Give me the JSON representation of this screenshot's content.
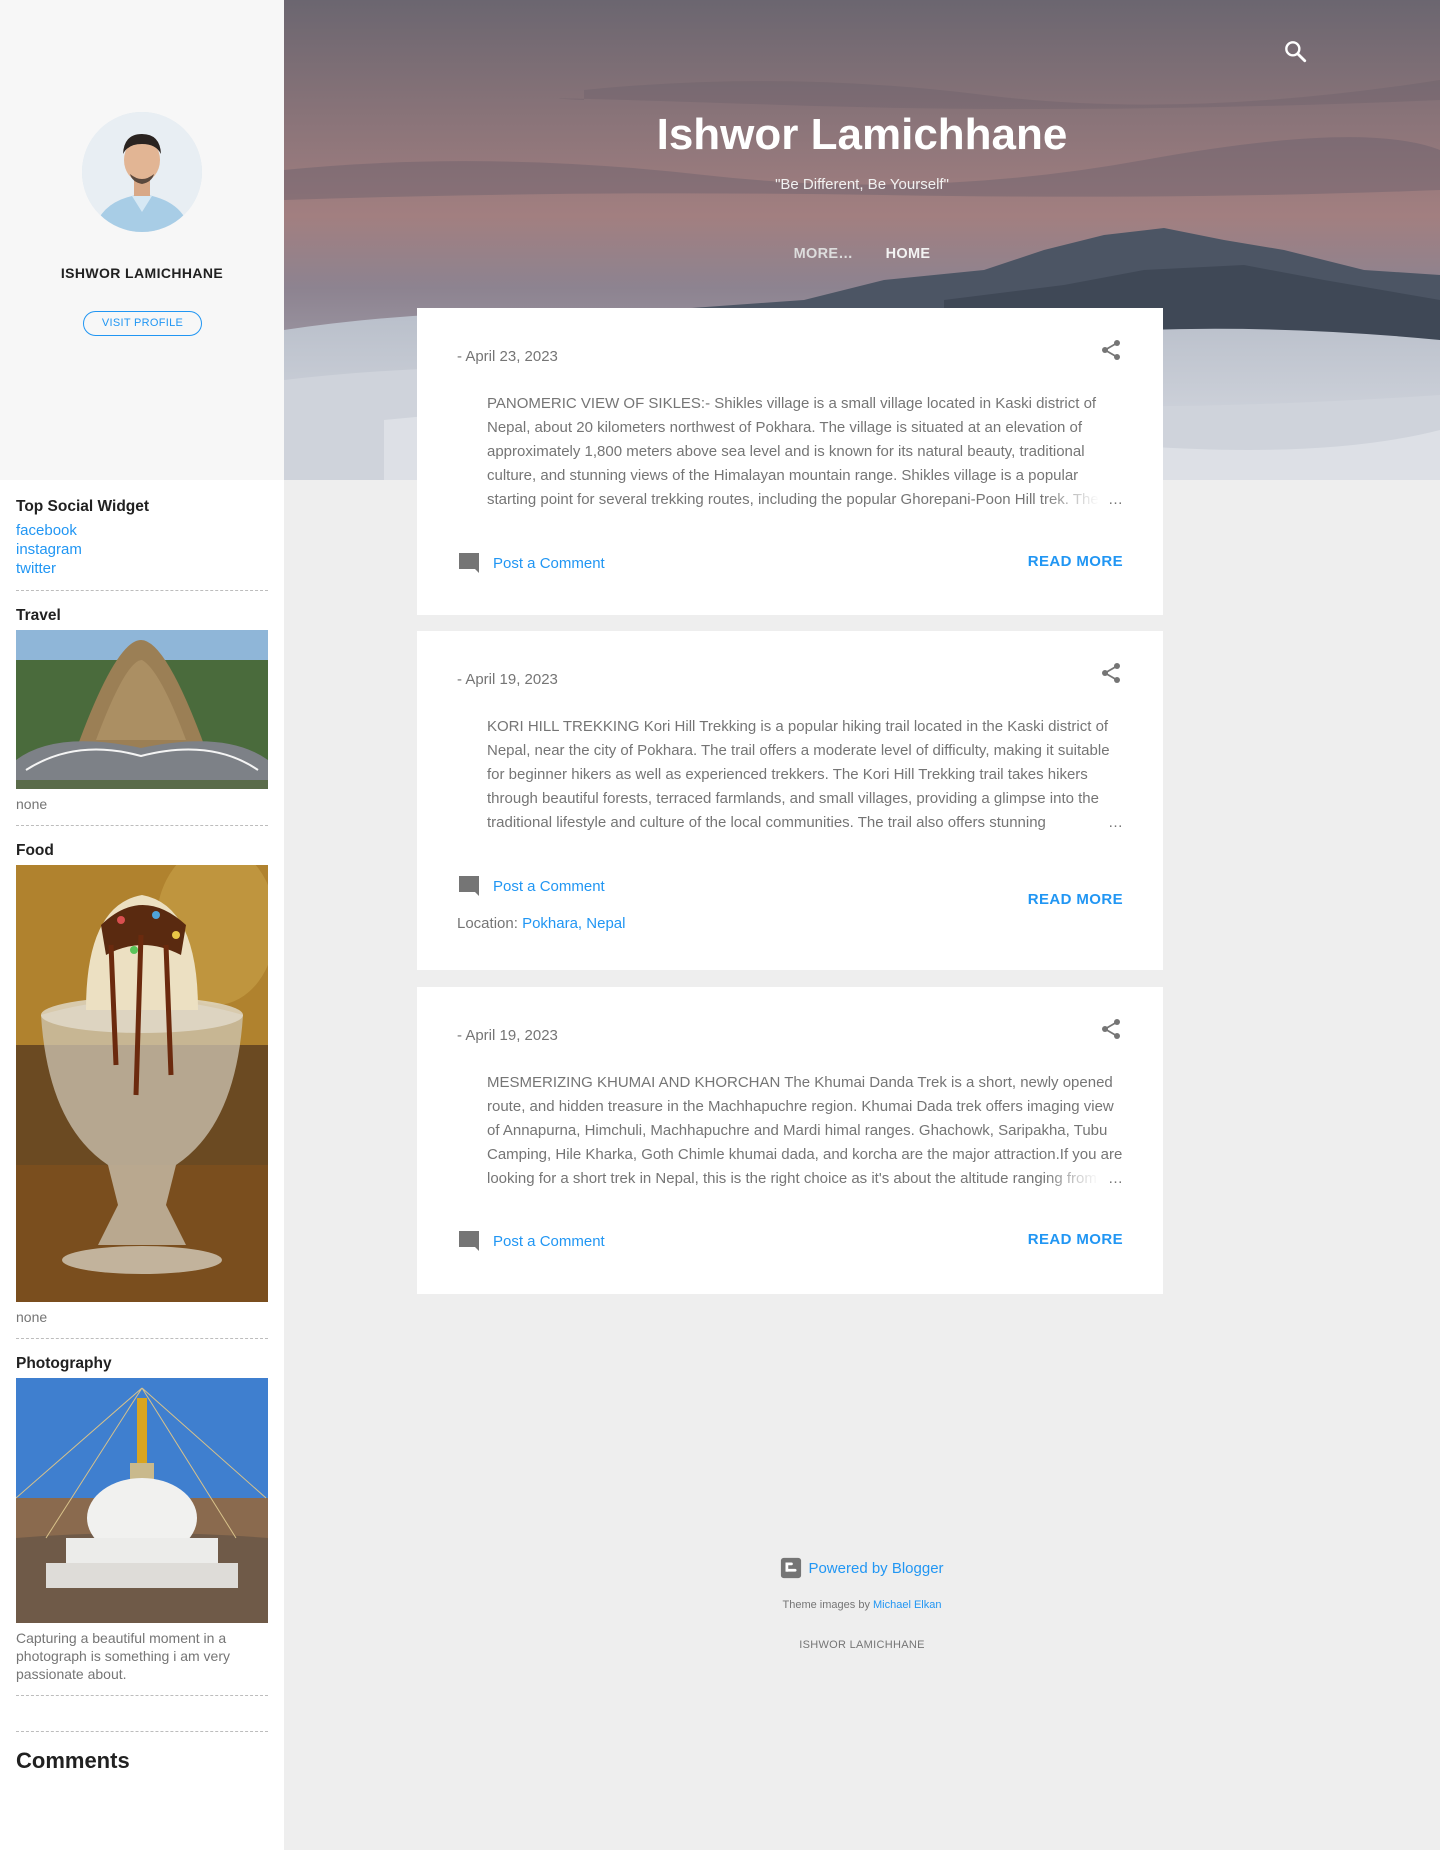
{
  "profile": {
    "name": "ISHWOR LAMICHHANE",
    "visit_label": "VISIT PROFILE"
  },
  "header": {
    "title": "Ishwor Lamichhane",
    "description": "\"Be Different, Be Yourself\"",
    "nav": [
      "MORE…",
      "HOME"
    ]
  },
  "sidebar": {
    "social": {
      "title": "Top Social Widget",
      "links": [
        "facebook",
        "instagram",
        "twitter"
      ]
    },
    "travel": {
      "title": "Travel",
      "caption": "none"
    },
    "food": {
      "title": "Food",
      "caption": "none"
    },
    "photography": {
      "title": "Photography",
      "caption": "Capturing a beautiful moment in a photograph is something i am very passionate about."
    },
    "comments_title": "Comments"
  },
  "posts": [
    {
      "date": "- April 23, 2023",
      "snippet": "PANOMERIC VIEW OF SIKLES:-  Shikles village is a small village located in Kaski district of Nepal, about 20 kilometers northwest of Pokhara. The village is situated at an elevation of approximately 1,800 meters above sea level and is known for its natural beauty, traditional culture, and stunning views of the Himalayan mountain range. Shikles village is a popular starting point for several trekking routes, including the popular Ghorepani-Poon Hill trek. The",
      "ellipsis": "…",
      "comment_label": "Post a Comment",
      "read_more": "READ MORE"
    },
    {
      "date": "- April 19, 2023",
      "snippet": " KORI HILL TREKKING Kori Hill Trekking is a popular hiking trail located in the Kaski district of Nepal, near the city of Pokhara. The trail offers a moderate level of difficulty, making it suitable for beginner hikers as well as experienced trekkers. The Kori Hill Trekking trail takes hikers through beautiful forests, terraced farmlands, and small villages, providing a glimpse into the traditional lifestyle and culture of the local communities. The trail also offers stunning",
      "ellipsis": "…",
      "comment_label": "Post a Comment",
      "read_more": "READ MORE",
      "location_label": "Location:",
      "location": "Pokhara, Nepal"
    },
    {
      "date": "- April 19, 2023",
      "snippet": "  MESMERIZING KHUMAI AND KHORCHAN The  Khumai Danda Trek is a short, newly opened route, and hidden treasure in the Machhapuchre region. Khumai Dada trek offers imaging view of Annapurna, Himchuli, Machhapuchre and Mardi himal ranges. Ghachowk, Saripakha, Tubu Camping, Hile Kharka, Goth Chimle khumai dada, and korcha are the major attraction.If you are looking for a short trek in Nepal, this is the right choice as it's about the altitude ranging from",
      "ellipsis": "…",
      "comment_label": "Post a Comment",
      "read_more": "READ MORE"
    }
  ],
  "footer": {
    "powered": "Powered by Blogger",
    "theme_prefix": "Theme images by ",
    "theme_author": "Michael Elkan",
    "name": "ISHWOR LAMICHHANE"
  },
  "colors": {
    "accent": "#2196f3",
    "sidebar_bg": "#f7f7f7",
    "page_bg": "#eeeeee",
    "text": "#757575",
    "heading": "#212121"
  },
  "icons": [
    "search-icon",
    "share-icon",
    "comment-icon",
    "blogger-icon"
  ]
}
